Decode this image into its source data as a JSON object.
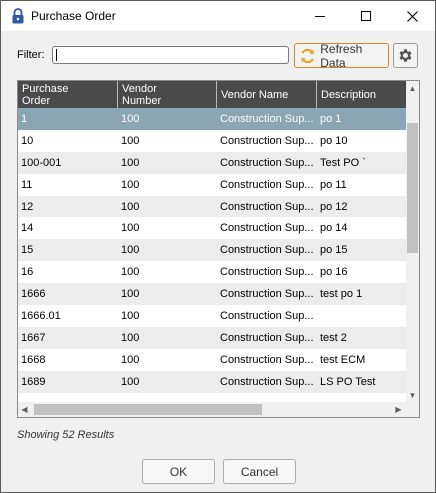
{
  "window": {
    "title": "Purchase Order"
  },
  "filter": {
    "label": "Filter:",
    "value": ""
  },
  "toolbar": {
    "refresh_label": "Refresh Data"
  },
  "grid": {
    "columns": [
      "Purchase\nOrder",
      "Vendor\nNumber",
      "Vendor Name",
      "Description"
    ],
    "rows": [
      [
        "1",
        "100",
        "Construction Sup...",
        "po 1"
      ],
      [
        "10",
        "100",
        "Construction Sup...",
        "po 10"
      ],
      [
        "100-001",
        "100",
        "Construction Sup...",
        "Test PO `"
      ],
      [
        "11",
        "100",
        "Construction Sup...",
        "po 11"
      ],
      [
        "12",
        "100",
        "Construction Sup...",
        "po 12"
      ],
      [
        "14",
        "100",
        "Construction Sup...",
        "po 14"
      ],
      [
        "15",
        "100",
        "Construction Sup...",
        "po 15"
      ],
      [
        "16",
        "100",
        "Construction Sup...",
        "po 16"
      ],
      [
        "1666",
        "100",
        "Construction Sup...",
        "test po 1"
      ],
      [
        "1666.01",
        "100",
        "Construction Sup...",
        ""
      ],
      [
        "1667",
        "100",
        "Construction Sup...",
        "test 2"
      ],
      [
        "1668",
        "100",
        "Construction Sup...",
        "test ECM"
      ],
      [
        "1689",
        "100",
        "Construction Sup...",
        "LS PO Test"
      ]
    ],
    "selected_row": 0
  },
  "status": {
    "results_text": "Showing 52 Results"
  },
  "footer": {
    "ok_label": "OK",
    "cancel_label": "Cancel"
  },
  "colors": {
    "header_bg": "#4a4a4a",
    "selected_row": "#8aa5b4",
    "refresh_accent": "#f0a020"
  }
}
